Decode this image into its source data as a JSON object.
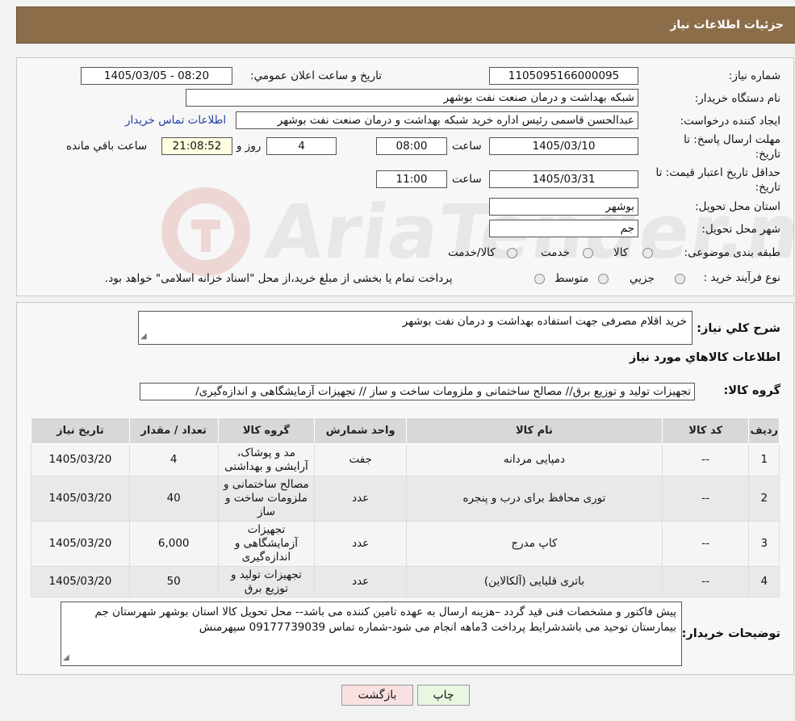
{
  "header": {
    "title": "جزئيات اطلاعات نياز"
  },
  "info": {
    "need_number_label": "شماره نياز:",
    "need_number": "1105095166000095",
    "announce_label": "تاريخ و ساعت اعلان عمومي:",
    "announce_value": "1405/03/05 - 08:20",
    "buyer_org_label": "نام دستگاه خريدار:",
    "buyer_org": "شبکه بهداشت و درمان صنعت نفت بوشهر",
    "requester_label": "ايجاد کننده درخواست:",
    "requester": "عبدالحسن قاسمی رئیس اداره خرید  شبکه بهداشت و درمان صنعت نفت بوشهر",
    "contact_link": "اطلاعات تماس خريدار",
    "deadline_label_1": "مهلت ارسال پاسخ: تا",
    "deadline_label_2": "تاريخ:",
    "deadline_date": "1405/03/10",
    "deadline_time_label": "ساعت",
    "deadline_time": "08:00",
    "days_value": "4",
    "days_label": "روز و",
    "remaining_time": "21:08:52",
    "remaining_label": "ساعت باقي مانده",
    "validity_label_1": "حداقل تاريخ اعتبار قيمت: تا",
    "validity_label_2": "تاريخ:",
    "validity_date": "1405/03/31",
    "validity_time_label": "ساعت",
    "validity_time": "11:00",
    "province_label": "استان محل تحويل:",
    "province": "بوشهر",
    "city_label": "شهر محل تحويل:",
    "city": "جم",
    "category_label": "طبقه بندی موضوعی:",
    "category_options": [
      "کالا",
      "خدمت",
      "کالا/خدمت"
    ],
    "process_label": "نوع فرآيند خريد :",
    "process_options": [
      "جزيي",
      "متوسط"
    ],
    "process_note": "پرداخت تمام يا بخشی از مبلغ خريد،از محل \"اسناد خزانه اسلامی\" خواهد بود."
  },
  "watermark": {
    "text": "AriaTender.neT"
  },
  "summary": {
    "desc_label": "شرح کلي نياز:",
    "desc": "خريد اقلام مصرفی جهت استفاده بهداشت و درمان نفت بوشهر",
    "goods_info_title": "اطلاعات کالاهاي مورد نياز",
    "group_label": "گروه کالا:",
    "group_value": "تجهیزات تولید و توزیع برق// مصالح ساختمانی و ملزومات ساخت و ساز // تجهیزات آزمایشگاهی و اندازه‌گیری/"
  },
  "table": {
    "headers": [
      "رديف",
      "کد کالا",
      "نام کالا",
      "واحد شمارش",
      "گروه کالا",
      "تعداد / مقدار",
      "تاريخ نياز"
    ],
    "rows": [
      {
        "row": "1",
        "code": "--",
        "name": "دمپایی مردانه",
        "unit": "جفت",
        "group": "مد و پوشاک، آرایشی و بهداشتی",
        "qty": "4",
        "date": "1405/03/20"
      },
      {
        "row": "2",
        "code": "--",
        "name": "توری محافظ برای درب و پنجره",
        "unit": "عدد",
        "group": "مصالح ساختمانی و ملزومات ساخت و ساز",
        "qty": "40",
        "date": "1405/03/20"
      },
      {
        "row": "3",
        "code": "--",
        "name": "کاپ مدرج",
        "unit": "عدد",
        "group": "تجهیزات آزمایشگاهی و اندازه‌گیری",
        "qty": "6,000",
        "date": "1405/03/20"
      },
      {
        "row": "4",
        "code": "--",
        "name": "باتری قلیایی (آلکالاین)",
        "unit": "عدد",
        "group": "تجهیزات تولید و توزیع برق",
        "qty": "50",
        "date": "1405/03/20"
      }
    ]
  },
  "buyer_notes": {
    "label": "توضيحات خريدار:",
    "text": "پیش فاکتور و مشخصات فنی قید گردد –هزینه ارسال به عهده تامین کننده می باشد-- محل تحویل کالا استان بوشهر شهرستان جم بیمارستان توحید می باشدشرایط پرداخت 3ماهه انجام می شود-شماره تماس 09177739039 سپهرمنش"
  },
  "buttons": {
    "print": "چاپ",
    "back": "بازگشت"
  },
  "colors": {
    "header_bg": "#8c6d4a",
    "print_bg": "#e9f7e1",
    "back_bg": "#f9e1e1",
    "link": "#1f3fa8"
  }
}
